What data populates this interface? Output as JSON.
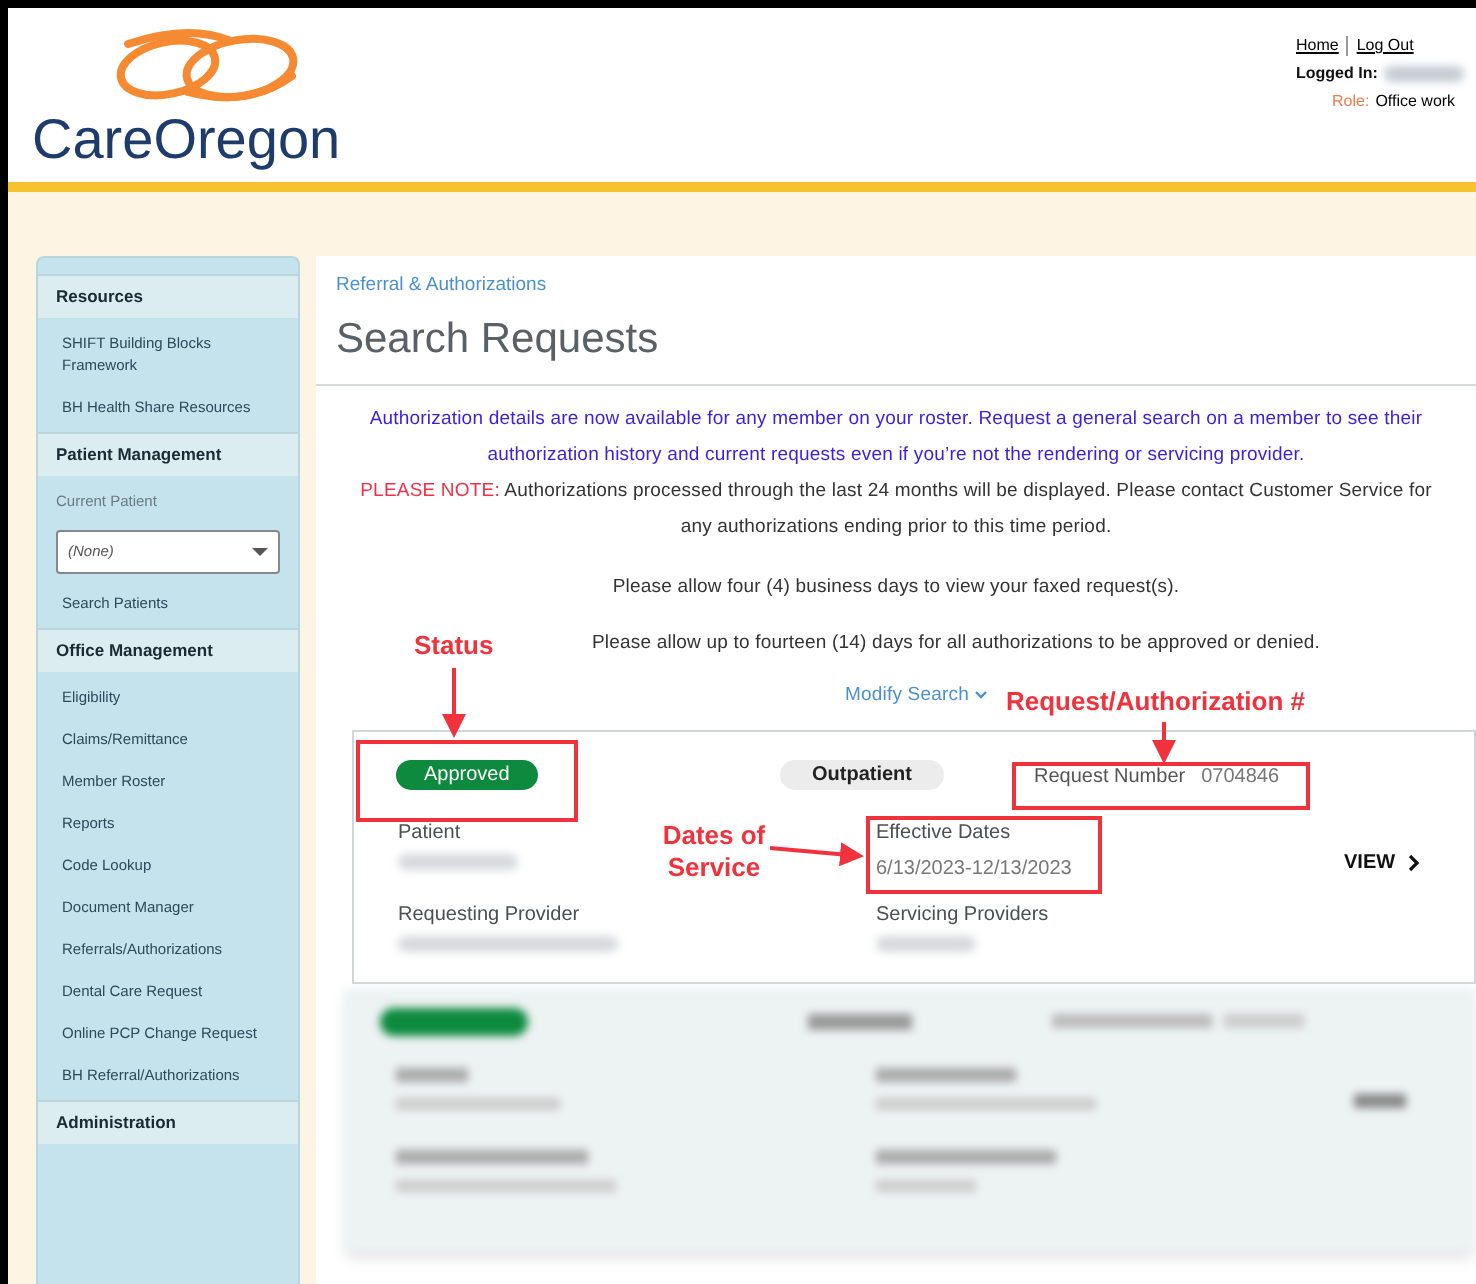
{
  "header": {
    "logo": "CareOregon",
    "links": [
      "Home",
      "Log Out"
    ],
    "logged_in_label": "Logged In:",
    "role_label": "Role:",
    "role": "Office work"
  },
  "sidebar": {
    "sections": [
      {
        "title": "Resources",
        "items": [
          {
            "kind": "link",
            "text": "SHIFT Building Blocks Framework"
          },
          {
            "kind": "link",
            "text": "BH Health Share Resources"
          }
        ]
      },
      {
        "title": "Patient Management",
        "items": [
          {
            "kind": "label",
            "text": "Current Patient"
          },
          {
            "kind": "select",
            "text": "(None)"
          },
          {
            "kind": "link",
            "text": "Search Patients"
          }
        ]
      },
      {
        "title": "Office Management",
        "items": [
          {
            "kind": "link",
            "text": "Eligibility"
          },
          {
            "kind": "link",
            "text": "Claims/Remittance"
          },
          {
            "kind": "link",
            "text": "Member Roster"
          },
          {
            "kind": "link",
            "text": "Reports"
          },
          {
            "kind": "link",
            "text": "Code Lookup"
          },
          {
            "kind": "link",
            "text": "Document Manager"
          },
          {
            "kind": "link",
            "text": "Referrals/Authorizations"
          },
          {
            "kind": "link",
            "text": "Dental Care Request"
          },
          {
            "kind": "link",
            "text": "Online PCP Change Request"
          },
          {
            "kind": "link",
            "text": "BH Referral/Authorizations"
          }
        ]
      },
      {
        "title": "Administration"
      }
    ]
  },
  "main": {
    "breadcrumb": "Referral & Authorizations",
    "title": "Search Requests",
    "notice": "Authorization details are now available for any member on your roster. Request a general search on a member to see their authorization history and current requests even if you’re not the rendering or servicing provider.",
    "note_label": "PLEASE NOTE:",
    "note": "Authorizations processed through the last 24 months will be displayed. Please contact Customer Service for any authorizations ending prior to this time period.",
    "fax_notice": "Please allow four (4) business days to view your faxed request(s).",
    "approval_notice": "Please allow up to fourteen (14) days for all authorizations to be approved or denied.",
    "modify_search": "Modify Search",
    "request": {
      "status": "Approved",
      "type": "Outpatient",
      "number_label": "Request Number",
      "number": "0704846",
      "fields": [
        {
          "label": "Patient"
        },
        {
          "label": "Effective Dates",
          "value": "6/13/2023-12/13/2023"
        },
        {
          "label": "Requesting Provider"
        },
        {
          "label": "Servicing Providers"
        }
      ],
      "view": "VIEW"
    },
    "annotations": [
      "Status",
      "Request/Authorization #",
      "Dates of Service"
    ]
  }
}
